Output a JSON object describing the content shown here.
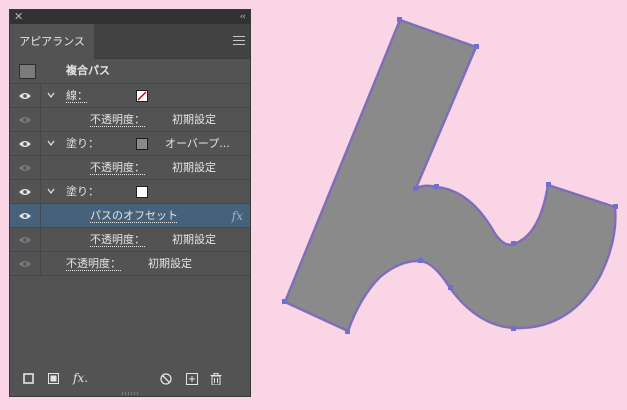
{
  "panel": {
    "tab_label": "アピアランス",
    "target_label": "複合パス",
    "rows": [
      {
        "label": "線：",
        "value": ""
      },
      {
        "label": "不透明度：",
        "value": "初期設定"
      },
      {
        "label": "塗り：",
        "value": "オーバープ..."
      },
      {
        "label": "不透明度：",
        "value": "初期設定"
      },
      {
        "label": "塗り：",
        "value": ""
      },
      {
        "label": "パスのオフセット",
        "value": "fx"
      },
      {
        "label": "不透明度：",
        "value": "初期設定"
      },
      {
        "label": "不透明度：",
        "value": "初期設定"
      }
    ]
  },
  "colors": {
    "background": "#f9d5e6",
    "shape_fill": "#8a8a8a",
    "path_stroke": "#6f6fcf",
    "selection_row": "#46627a"
  },
  "icons": [
    "close-icon",
    "collapse-icon",
    "panel-menu-icon",
    "visibility-eye-icon",
    "chevron-down-icon",
    "new-stroke-icon",
    "new-fill-icon",
    "fx-menu-icon",
    "clear-appearance-icon",
    "duplicate-item-icon",
    "trash-icon"
  ]
}
